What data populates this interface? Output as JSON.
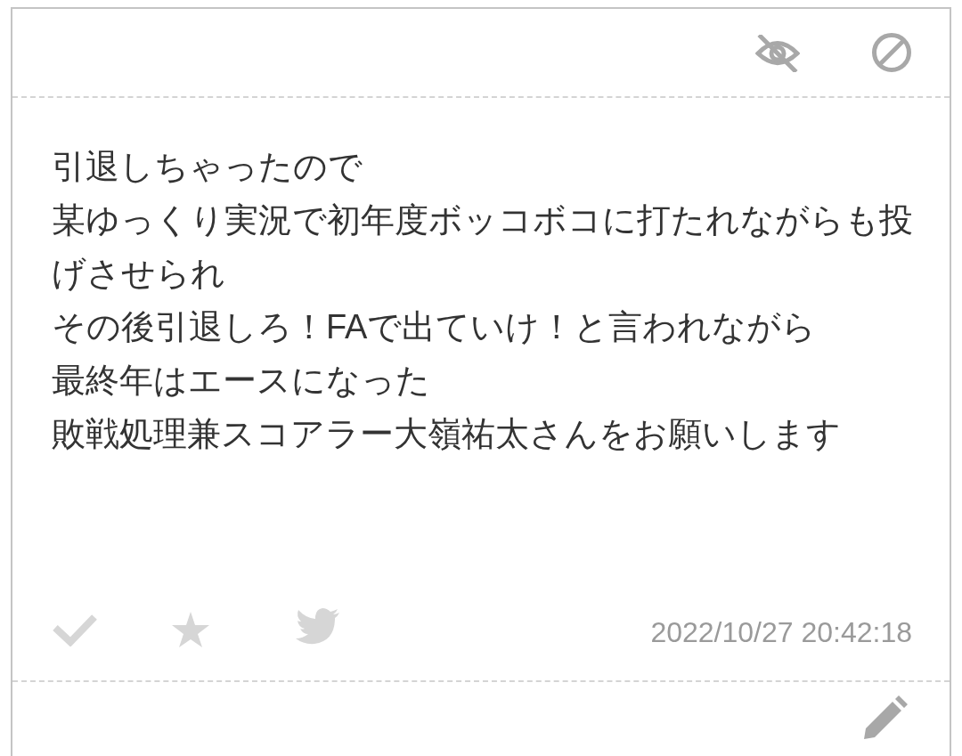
{
  "post": {
    "message_lines": [
      "引退しちゃったので",
      "某ゆっくり実況で初年度ボッコボコに打たれながらも投げさせられ",
      "その後引退しろ！FAで出ていけ！と言われながら",
      "最終年はエースになった",
      "敗戦処理兼スコアラー大嶺祐太さんをお願いします"
    ],
    "timestamp": "2022/10/27 20:42:18"
  }
}
